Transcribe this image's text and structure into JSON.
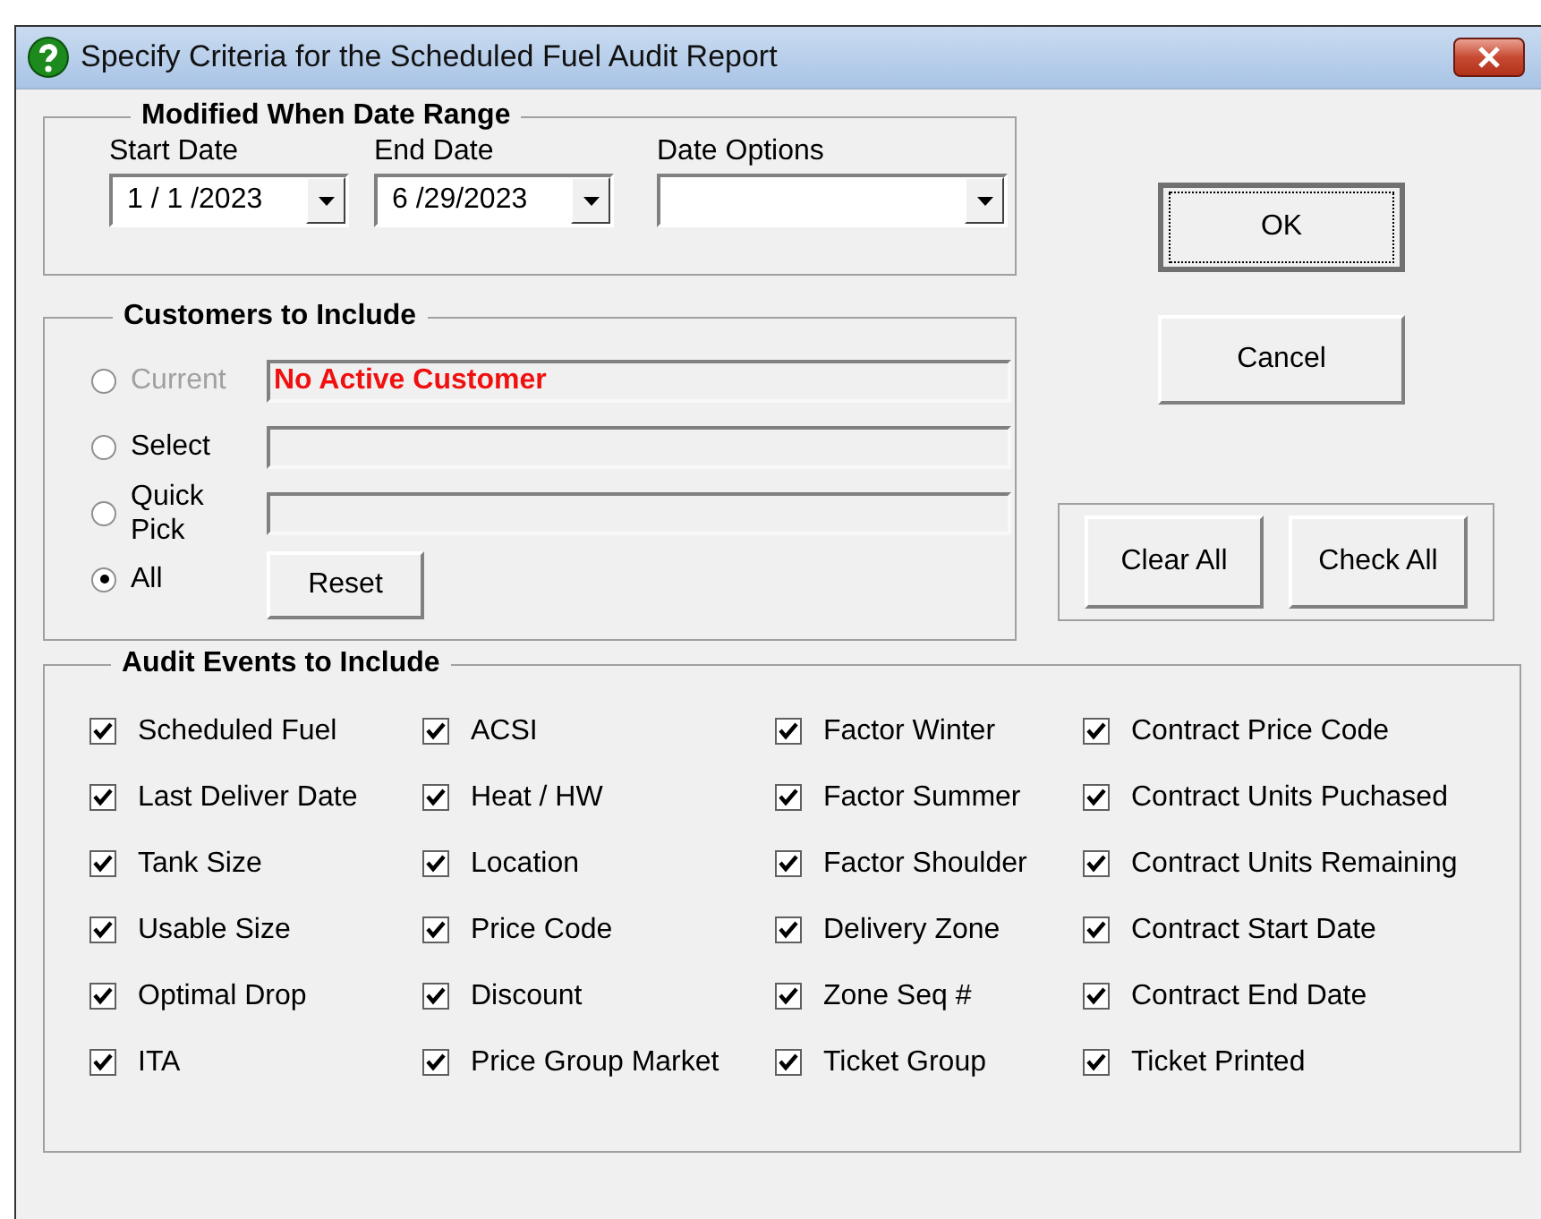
{
  "window": {
    "title": "Specify Criteria for the Scheduled Fuel Audit Report"
  },
  "date_range": {
    "title": "Modified When Date Range",
    "fields": [
      {
        "label": "Start Date",
        "value": "1 / 1 /2023",
        "kind": "date"
      },
      {
        "label": "End Date",
        "value": "6 /29/2023",
        "kind": "date"
      },
      {
        "label": "Date Options",
        "kind": "combo"
      }
    ]
  },
  "customers": {
    "title": "Customers to Include",
    "options": [
      {
        "label": "Current",
        "selected": false,
        "disabled": true,
        "kind": "field",
        "value": "No Active Customer"
      },
      {
        "label": "Select",
        "selected": false,
        "disabled": false,
        "kind": "field"
      },
      {
        "label": "Quick Pick",
        "selected": false,
        "disabled": false,
        "kind": "field"
      },
      {
        "label": "All",
        "selected": true,
        "disabled": false,
        "kind": "button",
        "button": "Reset"
      }
    ]
  },
  "buttons": [
    "OK",
    "Cancel"
  ],
  "check_buttons": [
    "Clear All",
    "Check All"
  ],
  "audit_events": {
    "title": "Audit Events to Include",
    "columns": [
      [
        {
          "label": "Scheduled Fuel",
          "checked": true
        },
        {
          "label": "Last Deliver Date",
          "checked": true
        },
        {
          "label": "Tank Size",
          "checked": true
        },
        {
          "label": "Usable Size",
          "checked": true
        },
        {
          "label": "Optimal Drop",
          "checked": true
        },
        {
          "label": "ITA",
          "checked": true
        }
      ],
      [
        {
          "label": "ACSI",
          "checked": true
        },
        {
          "label": "Heat / HW",
          "checked": true
        },
        {
          "label": "Location",
          "checked": true
        },
        {
          "label": "Price Code",
          "checked": true
        },
        {
          "label": "Discount",
          "checked": true
        },
        {
          "label": "Price Group Market",
          "checked": true
        }
      ],
      [
        {
          "label": "Factor Winter",
          "checked": true
        },
        {
          "label": "Factor Summer",
          "checked": true
        },
        {
          "label": "Factor Shoulder",
          "checked": true
        },
        {
          "label": "Delivery Zone",
          "checked": true
        },
        {
          "label": "Zone Seq #",
          "checked": true
        },
        {
          "label": "Ticket Group",
          "checked": true
        }
      ],
      [
        {
          "label": "Contract Price Code",
          "checked": true
        },
        {
          "label": "Contract Units Puchased",
          "checked": true
        },
        {
          "label": "Contract Units Remaining",
          "checked": true
        },
        {
          "label": "Contract Start Date",
          "checked": true
        },
        {
          "label": "Contract End Date",
          "checked": true
        },
        {
          "label": "Ticket Printed",
          "checked": true
        }
      ]
    ]
  }
}
